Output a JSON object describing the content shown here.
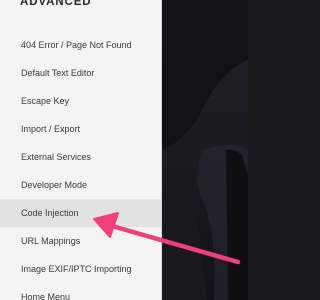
{
  "sidebar": {
    "section_title": "ADVANCED",
    "items": [
      {
        "label": "404 Error / Page Not Found"
      },
      {
        "label": "Default Text Editor"
      },
      {
        "label": "Escape Key"
      },
      {
        "label": "Import / Export"
      },
      {
        "label": "External Services"
      },
      {
        "label": "Developer Mode"
      },
      {
        "label": "Code Injection",
        "active": true
      },
      {
        "label": "URL Mappings"
      },
      {
        "label": "Image EXIF/IPTC Importing"
      },
      {
        "label": "Home Menu"
      }
    ]
  },
  "annotation": {
    "arrow_color": "#f0407a",
    "points_to": "Code Injection"
  },
  "colors": {
    "sidebar_bg": "#f4f4f4",
    "active_item_bg": "#e2e2e2",
    "preview_bg": "#1a1a1c"
  }
}
